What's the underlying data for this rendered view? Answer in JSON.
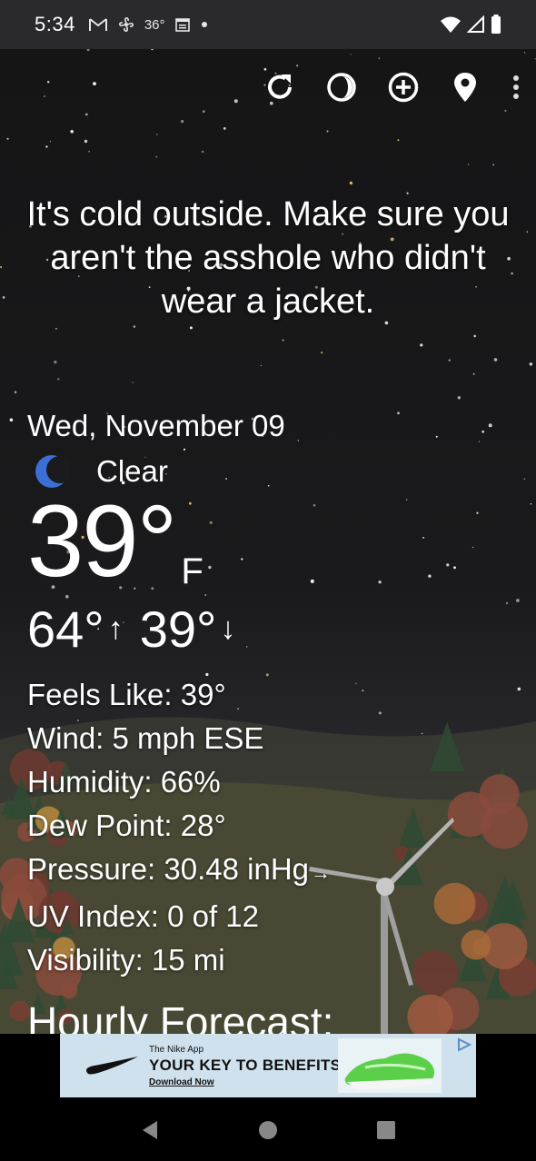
{
  "status_bar": {
    "time": "5:34",
    "temp": "36°"
  },
  "headline": "It's cold outside. Make sure you aren't the asshole who didn't wear a jacket.",
  "current": {
    "date": "Wed, November 09",
    "condition": "Clear",
    "temperature": "39°",
    "unit": "F",
    "high": "64°",
    "low": "39°",
    "high_arrow": "↑",
    "low_arrow": "↓"
  },
  "details": {
    "feels_like": "Feels Like:  39°",
    "wind": "Wind:  5 mph ESE",
    "humidity": "Humidity:  66%",
    "dew_point": "Dew Point:  28°",
    "pressure": "Pressure:  30.48 inHg",
    "pressure_trend": "→",
    "uv_index": "UV Index:  0 of 12",
    "visibility": "Visibility:  15 mi"
  },
  "hourly_heading": "Hourly Forecast:",
  "ad": {
    "app": "The Nike App",
    "title": "YOUR KEY TO BENEFITS",
    "cta": "Download Now"
  },
  "icons": {
    "refresh": "refresh-icon",
    "theme": "theme-icon",
    "add": "add-location-icon",
    "location": "location-pin-icon",
    "more": "more-vert-icon",
    "condition": "moon-icon"
  },
  "colors": {
    "moon": "#3b6fd6",
    "ad_bg": "#cfe1ec"
  }
}
